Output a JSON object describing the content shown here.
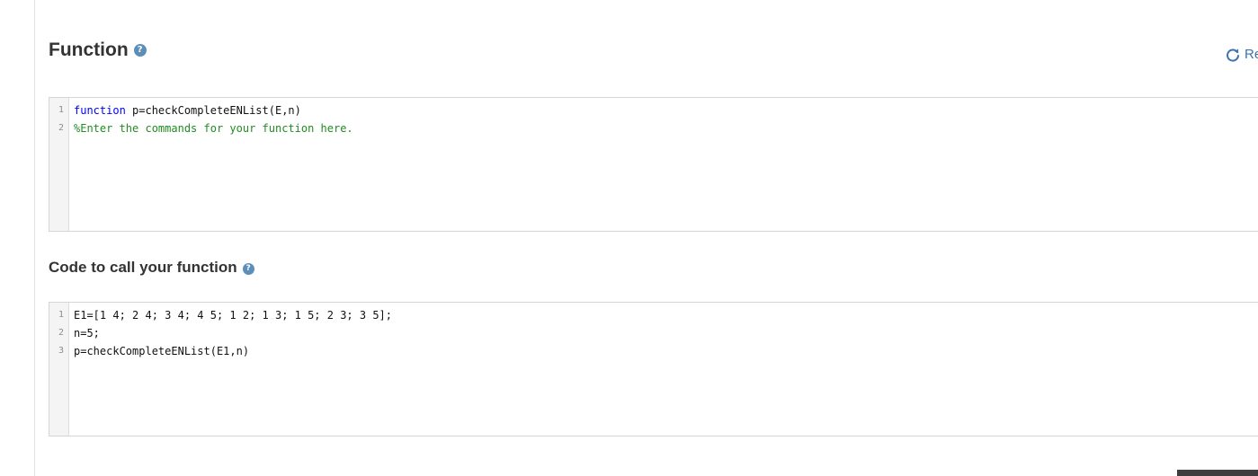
{
  "function_section": {
    "title": "Function",
    "help_icon": "?",
    "reset_label": "Re",
    "code_lines": [
      {
        "number": "1",
        "keyword": "function",
        "text": " p=checkCompleteENList(E,n)"
      },
      {
        "number": "2",
        "comment": "%Enter the commands for your function here."
      }
    ]
  },
  "call_section": {
    "title": "Code to call your function",
    "help_icon": "?",
    "code_lines": [
      {
        "number": "1",
        "text": "E1=[1 4; 2 4; 3 4; 4 5; 1 2; 1 3; 1 5; 2 3; 3 5];"
      },
      {
        "number": "2",
        "text": "n=5;"
      },
      {
        "number": "3",
        "text": "p=checkCompleteENList(E1,n)"
      }
    ]
  }
}
